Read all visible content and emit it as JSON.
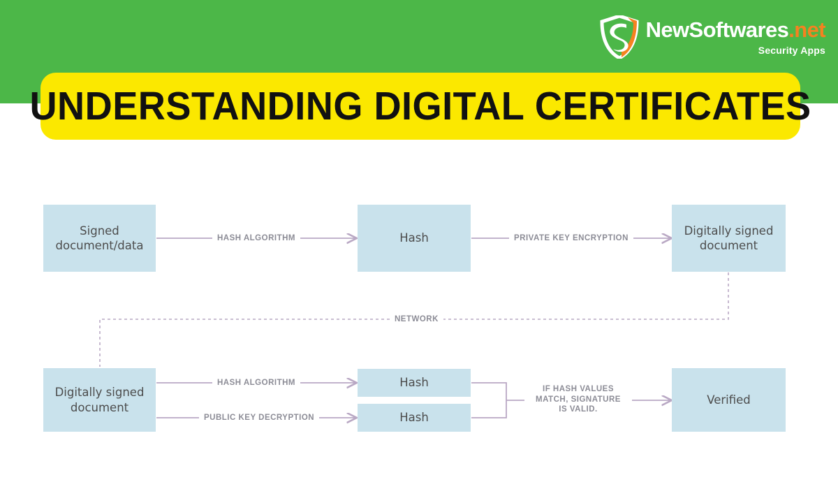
{
  "header": {
    "band_color": "#4CB748",
    "logo": {
      "icon": "shield-logo-icon",
      "name_main": "NewSoftwares",
      "name_tld": ".net",
      "tagline": "Security Apps"
    }
  },
  "title_bar": {
    "text": "UNDERSTANDING DIGITAL CERTIFICATES",
    "background": "#FBE800",
    "text_color": "#111111"
  },
  "diagram": {
    "node_fill": "#C9E2EC",
    "node_text_color": "#4C4C4C",
    "wire_color": "#B9A8C4",
    "label_color": "#8C8C96",
    "nodes": {
      "signed_document": "Signed\ndocument/data",
      "hash_top": "Hash",
      "digitally_signed_top": "Digitally signed\ndocument",
      "digitally_signed_bottom": "Digitally signed\ndocument",
      "hash_bottom_1": "Hash",
      "hash_bottom_2": "Hash",
      "verified": "Verified"
    },
    "labels": {
      "hash_algorithm_top": "HASH ALGORITHM",
      "private_key_encryption": "PRIVATE KEY ENCRYPTION",
      "network": "NETWORK",
      "hash_algorithm_bottom": "HASH ALGORITHM",
      "public_key_decryption": "PUBLIC KEY DECRYPTION",
      "match_signature": "IF HASH VALUES\nMATCH, SIGNATURE\nIS VALID."
    }
  }
}
